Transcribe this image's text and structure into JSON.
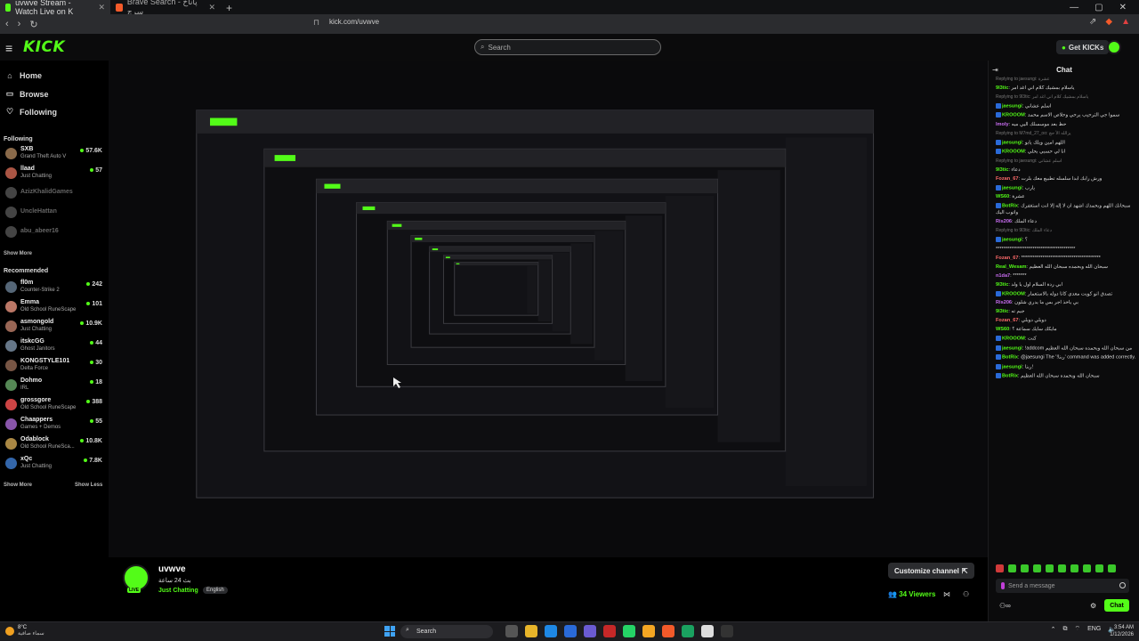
{
  "browser": {
    "tabs": [
      {
        "title": "uvwve Stream - Watch Live on K",
        "active": true
      },
      {
        "title": "Brave Search - پاناخ سرچ",
        "active": false
      }
    ],
    "address": "kick.com/uvwve"
  },
  "header": {
    "logo": "KICK",
    "search_placeholder": "Search",
    "get_kicks": "Get KICKs"
  },
  "sidebar": {
    "nav": [
      {
        "label": "Home",
        "icon": "home-icon"
      },
      {
        "label": "Browse",
        "icon": "browse-icon"
      },
      {
        "label": "Following",
        "icon": "heart-icon"
      }
    ],
    "following_title": "Following",
    "following": [
      {
        "name": "SXB",
        "category": "Grand Theft Auto V",
        "viewers": "57.6K",
        "online": true,
        "color": "#8a6a4a"
      },
      {
        "name": "llaad",
        "category": "Just Chatting",
        "viewers": "57",
        "online": true,
        "color": "#aa5544"
      },
      {
        "name": "AzizKhalidGames",
        "category": "",
        "viewers": "",
        "online": false,
        "color": "#444"
      },
      {
        "name": "UncleHattan",
        "category": "",
        "viewers": "",
        "online": false,
        "color": "#444"
      },
      {
        "name": "abu_abeer16",
        "category": "",
        "viewers": "",
        "online": false,
        "color": "#444"
      }
    ],
    "show_more_following": "Show More",
    "recommended_title": "Recommended",
    "recommended": [
      {
        "name": "fl0m",
        "category": "Counter-Strike 2",
        "viewers": "242",
        "color": "#556677"
      },
      {
        "name": "Emma",
        "category": "Old School RuneScape",
        "viewers": "101",
        "color": "#bb7766"
      },
      {
        "name": "asmongold",
        "category": "Just Chatting",
        "viewers": "10.9K",
        "color": "#996655"
      },
      {
        "name": "itskcGG",
        "category": "Ghost Janitors",
        "viewers": "44",
        "color": "#667788"
      },
      {
        "name": "KONGSTYLE101",
        "category": "Delta Force",
        "viewers": "30",
        "color": "#775544"
      },
      {
        "name": "Dohmo",
        "category": "IRL",
        "viewers": "18",
        "color": "#558855"
      },
      {
        "name": "grossgore",
        "category": "Old School RuneScape",
        "viewers": "388",
        "color": "#cc4444"
      },
      {
        "name": "Chaappers",
        "category": "Games + Demos",
        "viewers": "55",
        "color": "#8855aa"
      },
      {
        "name": "Odablock",
        "category": "Old School RuneSca...",
        "viewers": "10.8K",
        "color": "#aa8844"
      },
      {
        "name": "xQc",
        "category": "Just Chatting",
        "viewers": "7.8K",
        "color": "#3366aa"
      }
    ],
    "show_more": "Show More",
    "show_less": "Show Less"
  },
  "stream": {
    "streamer": "uvwve",
    "title": "بث 24 ساعة",
    "category": "Just Chatting",
    "language": "English",
    "live_badge": "LIVE",
    "customize_label": "Customize channel",
    "viewers": "34 Viewers"
  },
  "chat": {
    "title": "Chat",
    "messages": [
      {
        "reply": "Replying to jaesungi: عشرة",
        "user": "",
        "text": "",
        "color": "#777"
      },
      {
        "reply": "",
        "user": "9l3tic",
        "text": "ياسلام بمشيك كلام اني اغد امر",
        "color": "#53fc18"
      },
      {
        "reply": "Replying to 9l3tic: ياسلام بمشيك كلام اني اغد امر",
        "user": "",
        "text": "",
        "color": "#777"
      },
      {
        "reply": "",
        "user": "jaesungi",
        "text": "اسلم عشاني",
        "color": "#53fc18",
        "badge": true
      },
      {
        "reply": "",
        "user": "KROOOM",
        "text": "سموا جي الترحيب يرحي وحلاص الاسم محمد",
        "color": "#53fc18",
        "badge": true
      },
      {
        "reply": "",
        "user": "lmoly",
        "text": "حظ بعد موسسلك اليي ميه",
        "color": "#c96df2"
      },
      {
        "reply": "Replying to M7md_27_oo: يزالله الأ حج",
        "user": "",
        "text": "",
        "color": "#777"
      },
      {
        "reply": "",
        "user": "jaesungi",
        "text": "اللهم امين ويلك يابو",
        "color": "#53fc18",
        "badge": true
      },
      {
        "reply": "",
        "user": "KROOOM",
        "text": "انا لي حسبي بحلي",
        "color": "#53fc18",
        "badge": true
      },
      {
        "reply": "Replying to jaesungi: اسلم عشاني",
        "user": "",
        "text": "",
        "color": "#777"
      },
      {
        "reply": "",
        "user": "9l3tic",
        "text": "دعاء",
        "color": "#53fc18"
      },
      {
        "reply": "",
        "user": "Fozan_67",
        "text": "ورش رابك ابدا سلسله تطبيع معك بلرت",
        "color": "#ff6b6b"
      },
      {
        "reply": "",
        "user": "jaesungi",
        "text": "يارب",
        "color": "#53fc18",
        "badge": true
      },
      {
        "reply": "",
        "user": "WS60",
        "text": "عشرة",
        "color": "#53fc18"
      },
      {
        "reply": "",
        "user": "BotRix",
        "text": "سبحانك اللهم وبحمدك اشهد ان لا إله إلا انت استغفرك واتوب اليك",
        "color": "#53fc18",
        "badge": true
      },
      {
        "reply": "",
        "user": "Ris206",
        "text": "دعاء الملك",
        "color": "#c96df2"
      },
      {
        "reply": "Replying to 9l3tic: دعاء الملك",
        "user": "",
        "text": "",
        "color": "#777"
      },
      {
        "reply": "",
        "user": "jaesungi",
        "text": "؟",
        "color": "#53fc18",
        "badge": true
      },
      {
        "reply": "",
        "user": "",
        "text": "*****************************************",
        "color": "#ddd"
      },
      {
        "reply": "",
        "user": "Fozan_67",
        "text": "*****************************************",
        "color": "#ff6b6b"
      },
      {
        "reply": "",
        "user": "Real_Wesam",
        "text": "سبحان الله وبحمده سبحان الله العظيم",
        "color": "#53fc18"
      },
      {
        "reply": "",
        "user": "n1da7",
        "text": "*******",
        "color": "#c96df2"
      },
      {
        "reply": "",
        "user": "9l3tic",
        "text": "ابي ردة السلام اول يا ولد",
        "color": "#53fc18"
      },
      {
        "reply": "",
        "user": "KROOOM",
        "text": "تصدق انو كويت معدي كانا دوله بالاستعمار",
        "color": "#53fc18",
        "badge": true
      },
      {
        "reply": "",
        "user": "Ris206",
        "text": "بي ياخذ اجر بس ما يدري شلون",
        "color": "#c96df2"
      },
      {
        "reply": "",
        "user": "9l3tic",
        "text": "جيم ته",
        "color": "#53fc18"
      },
      {
        "reply": "",
        "user": "Fozan_67",
        "text": "دوبلي دوبلي",
        "color": "#ff6b6b"
      },
      {
        "reply": "",
        "user": "WS60",
        "text": "مايكك سايك سماعة ؟",
        "color": "#53fc18"
      },
      {
        "reply": "",
        "user": "KROOOM",
        "text": "كنت",
        "color": "#53fc18",
        "badge": true
      },
      {
        "reply": "",
        "user": "jaesungi",
        "text": "!addcom من سبحان الله وبحمده سبحان الله العظيم",
        "color": "#53fc18",
        "badge": true
      },
      {
        "reply": "",
        "user": "BotRix",
        "text": "@jaesungi The '!ربنا' command was added correctly.",
        "color": "#53fc18",
        "badge": true
      },
      {
        "reply": "",
        "user": "jaesungi",
        "text": "ربنا!",
        "color": "#53fc18",
        "badge": true
      },
      {
        "reply": "",
        "user": "BotRix",
        "text": "سبحان الله وبحمده سبحان الله العظيم",
        "color": "#53fc18",
        "badge": true
      }
    ],
    "input_placeholder": "Send a message",
    "send_label": "Chat"
  },
  "taskbar": {
    "weather_temp": "8°C",
    "weather_desc": "سماء صافية",
    "search_label": "Search",
    "lang": "ENG",
    "time": "3:54 AM",
    "date": "1/12/2026"
  }
}
